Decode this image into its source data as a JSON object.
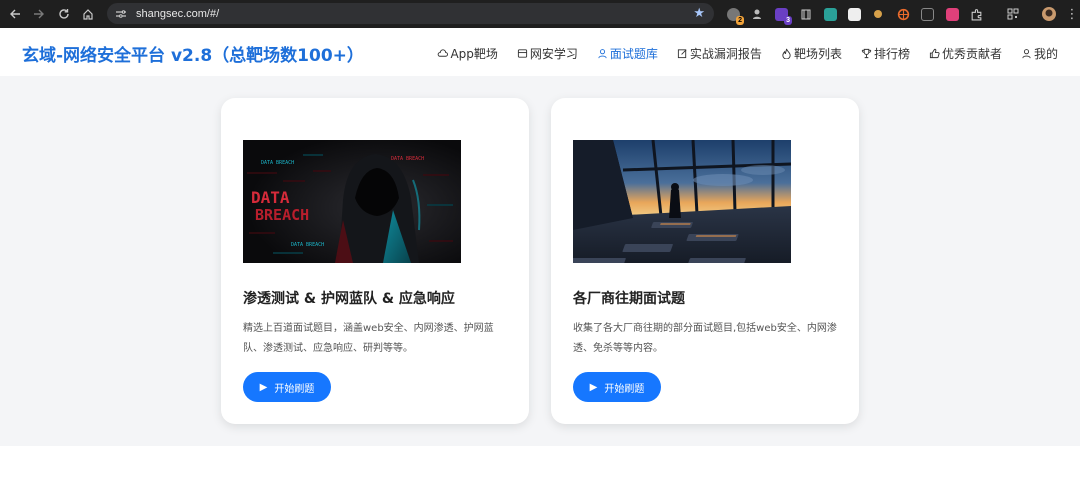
{
  "browser": {
    "url": "shangsec.com/#/",
    "extension_badges": [
      "2",
      "3"
    ]
  },
  "header": {
    "title": "玄域-网络安全平台 v2.8（总靶场数100+）",
    "nav": [
      {
        "label": "App靶场",
        "icon": "cloud-icon",
        "active": false
      },
      {
        "label": "网安学习",
        "icon": "book-icon",
        "active": false
      },
      {
        "label": "面试题库",
        "icon": "user-icon",
        "active": true
      },
      {
        "label": "实战漏洞报告",
        "icon": "edit-icon",
        "active": false
      },
      {
        "label": "靶场列表",
        "icon": "flame-icon",
        "active": false
      },
      {
        "label": "排行榜",
        "icon": "trophy-icon",
        "active": false
      },
      {
        "label": "优秀贡献者",
        "icon": "thumbs-up-icon",
        "active": false
      },
      {
        "label": "我的",
        "icon": "person-icon",
        "active": false
      }
    ]
  },
  "cards": [
    {
      "image_text": [
        "DATA BREACH",
        "DATA",
        "BREACH",
        "DATA BREACH",
        "DATA BREACH"
      ],
      "title": "渗透测试 & 护网蓝队 & 应急响应",
      "description": "精选上百道面试题目，涵盖web安全、内网渗透、护网蓝队、渗透测试、应急响应、研判等等。",
      "button": "开始刷题"
    },
    {
      "title": "各厂商往期面试题",
      "description": "收集了各大厂商往期的部分面试题目,包括web安全、内网渗透、免杀等等内容。",
      "button": "开始刷题"
    }
  ],
  "colors": {
    "accent": "#1e6fd9",
    "button": "#1677ff",
    "background": "#f4f5f7"
  }
}
